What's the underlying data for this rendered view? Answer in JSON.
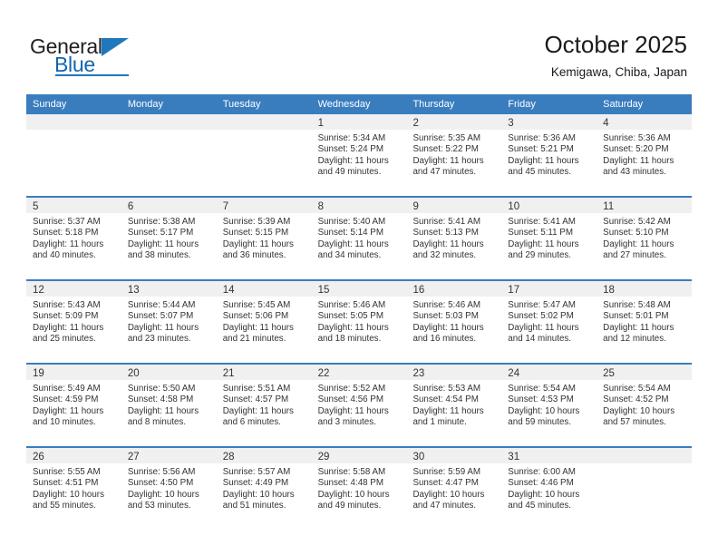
{
  "brand": {
    "name_part1": "General",
    "name_part2": "Blue",
    "triangle_color": "#1f77bc",
    "blue_color": "#1066b0"
  },
  "header": {
    "month_title": "October 2025",
    "location": "Kemigawa, Chiba, Japan"
  },
  "colors": {
    "header_blue": "#3a7dbf",
    "day_band_gray": "#f0f0f0",
    "text": "#333333"
  },
  "calendar": {
    "weekdays": [
      "Sunday",
      "Monday",
      "Tuesday",
      "Wednesday",
      "Thursday",
      "Friday",
      "Saturday"
    ],
    "weeks": [
      [
        {
          "day": "",
          "sunrise": "",
          "sunset": "",
          "daylight": "",
          "empty": true
        },
        {
          "day": "",
          "sunrise": "",
          "sunset": "",
          "daylight": "",
          "empty": true
        },
        {
          "day": "",
          "sunrise": "",
          "sunset": "",
          "daylight": "",
          "empty": true
        },
        {
          "day": "1",
          "sunrise": "Sunrise: 5:34 AM",
          "sunset": "Sunset: 5:24 PM",
          "daylight": "Daylight: 11 hours and 49 minutes."
        },
        {
          "day": "2",
          "sunrise": "Sunrise: 5:35 AM",
          "sunset": "Sunset: 5:22 PM",
          "daylight": "Daylight: 11 hours and 47 minutes."
        },
        {
          "day": "3",
          "sunrise": "Sunrise: 5:36 AM",
          "sunset": "Sunset: 5:21 PM",
          "daylight": "Daylight: 11 hours and 45 minutes."
        },
        {
          "day": "4",
          "sunrise": "Sunrise: 5:36 AM",
          "sunset": "Sunset: 5:20 PM",
          "daylight": "Daylight: 11 hours and 43 minutes."
        }
      ],
      [
        {
          "day": "5",
          "sunrise": "Sunrise: 5:37 AM",
          "sunset": "Sunset: 5:18 PM",
          "daylight": "Daylight: 11 hours and 40 minutes."
        },
        {
          "day": "6",
          "sunrise": "Sunrise: 5:38 AM",
          "sunset": "Sunset: 5:17 PM",
          "daylight": "Daylight: 11 hours and 38 minutes."
        },
        {
          "day": "7",
          "sunrise": "Sunrise: 5:39 AM",
          "sunset": "Sunset: 5:15 PM",
          "daylight": "Daylight: 11 hours and 36 minutes."
        },
        {
          "day": "8",
          "sunrise": "Sunrise: 5:40 AM",
          "sunset": "Sunset: 5:14 PM",
          "daylight": "Daylight: 11 hours and 34 minutes."
        },
        {
          "day": "9",
          "sunrise": "Sunrise: 5:41 AM",
          "sunset": "Sunset: 5:13 PM",
          "daylight": "Daylight: 11 hours and 32 minutes."
        },
        {
          "day": "10",
          "sunrise": "Sunrise: 5:41 AM",
          "sunset": "Sunset: 5:11 PM",
          "daylight": "Daylight: 11 hours and 29 minutes."
        },
        {
          "day": "11",
          "sunrise": "Sunrise: 5:42 AM",
          "sunset": "Sunset: 5:10 PM",
          "daylight": "Daylight: 11 hours and 27 minutes."
        }
      ],
      [
        {
          "day": "12",
          "sunrise": "Sunrise: 5:43 AM",
          "sunset": "Sunset: 5:09 PM",
          "daylight": "Daylight: 11 hours and 25 minutes."
        },
        {
          "day": "13",
          "sunrise": "Sunrise: 5:44 AM",
          "sunset": "Sunset: 5:07 PM",
          "daylight": "Daylight: 11 hours and 23 minutes."
        },
        {
          "day": "14",
          "sunrise": "Sunrise: 5:45 AM",
          "sunset": "Sunset: 5:06 PM",
          "daylight": "Daylight: 11 hours and 21 minutes."
        },
        {
          "day": "15",
          "sunrise": "Sunrise: 5:46 AM",
          "sunset": "Sunset: 5:05 PM",
          "daylight": "Daylight: 11 hours and 18 minutes."
        },
        {
          "day": "16",
          "sunrise": "Sunrise: 5:46 AM",
          "sunset": "Sunset: 5:03 PM",
          "daylight": "Daylight: 11 hours and 16 minutes."
        },
        {
          "day": "17",
          "sunrise": "Sunrise: 5:47 AM",
          "sunset": "Sunset: 5:02 PM",
          "daylight": "Daylight: 11 hours and 14 minutes."
        },
        {
          "day": "18",
          "sunrise": "Sunrise: 5:48 AM",
          "sunset": "Sunset: 5:01 PM",
          "daylight": "Daylight: 11 hours and 12 minutes."
        }
      ],
      [
        {
          "day": "19",
          "sunrise": "Sunrise: 5:49 AM",
          "sunset": "Sunset: 4:59 PM",
          "daylight": "Daylight: 11 hours and 10 minutes."
        },
        {
          "day": "20",
          "sunrise": "Sunrise: 5:50 AM",
          "sunset": "Sunset: 4:58 PM",
          "daylight": "Daylight: 11 hours and 8 minutes."
        },
        {
          "day": "21",
          "sunrise": "Sunrise: 5:51 AM",
          "sunset": "Sunset: 4:57 PM",
          "daylight": "Daylight: 11 hours and 6 minutes."
        },
        {
          "day": "22",
          "sunrise": "Sunrise: 5:52 AM",
          "sunset": "Sunset: 4:56 PM",
          "daylight": "Daylight: 11 hours and 3 minutes."
        },
        {
          "day": "23",
          "sunrise": "Sunrise: 5:53 AM",
          "sunset": "Sunset: 4:54 PM",
          "daylight": "Daylight: 11 hours and 1 minute."
        },
        {
          "day": "24",
          "sunrise": "Sunrise: 5:54 AM",
          "sunset": "Sunset: 4:53 PM",
          "daylight": "Daylight: 10 hours and 59 minutes."
        },
        {
          "day": "25",
          "sunrise": "Sunrise: 5:54 AM",
          "sunset": "Sunset: 4:52 PM",
          "daylight": "Daylight: 10 hours and 57 minutes."
        }
      ],
      [
        {
          "day": "26",
          "sunrise": "Sunrise: 5:55 AM",
          "sunset": "Sunset: 4:51 PM",
          "daylight": "Daylight: 10 hours and 55 minutes."
        },
        {
          "day": "27",
          "sunrise": "Sunrise: 5:56 AM",
          "sunset": "Sunset: 4:50 PM",
          "daylight": "Daylight: 10 hours and 53 minutes."
        },
        {
          "day": "28",
          "sunrise": "Sunrise: 5:57 AM",
          "sunset": "Sunset: 4:49 PM",
          "daylight": "Daylight: 10 hours and 51 minutes."
        },
        {
          "day": "29",
          "sunrise": "Sunrise: 5:58 AM",
          "sunset": "Sunset: 4:48 PM",
          "daylight": "Daylight: 10 hours and 49 minutes."
        },
        {
          "day": "30",
          "sunrise": "Sunrise: 5:59 AM",
          "sunset": "Sunset: 4:47 PM",
          "daylight": "Daylight: 10 hours and 47 minutes."
        },
        {
          "day": "31",
          "sunrise": "Sunrise: 6:00 AM",
          "sunset": "Sunset: 4:46 PM",
          "daylight": "Daylight: 10 hours and 45 minutes."
        },
        {
          "day": "",
          "sunrise": "",
          "sunset": "",
          "daylight": "",
          "empty": true
        }
      ]
    ]
  }
}
